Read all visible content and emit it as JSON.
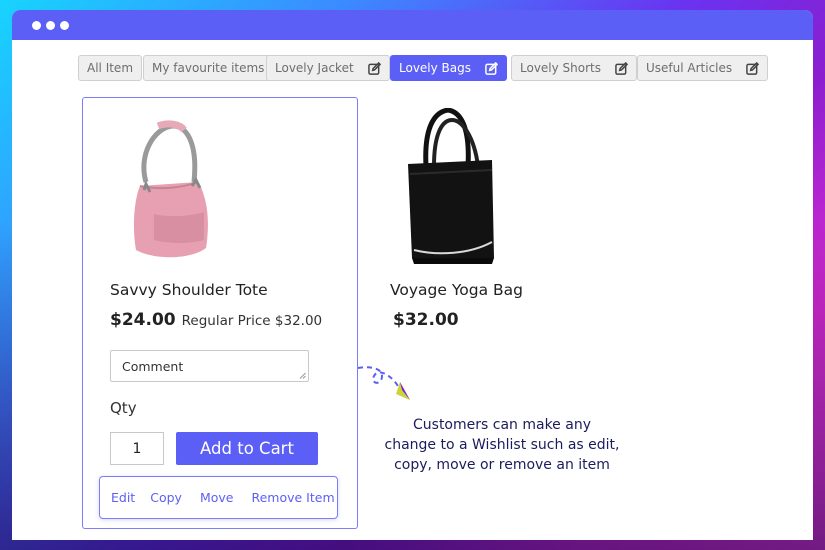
{
  "window": {
    "dots": 3,
    "accent_color": "#5c5ff6"
  },
  "tabs": [
    {
      "label": "All Item",
      "editable": false,
      "active": false
    },
    {
      "label": "My favourite items",
      "editable": false,
      "active": false
    },
    {
      "label": "Lovely Jacket",
      "editable": true,
      "active": false
    },
    {
      "label": "Lovely Bags",
      "editable": true,
      "active": true
    },
    {
      "label": "Lovely Shorts",
      "editable": true,
      "active": false
    },
    {
      "label": "Useful Articles",
      "editable": true,
      "active": false
    }
  ],
  "products": [
    {
      "name": "Savvy Shoulder Tote",
      "price": "$24.00",
      "regular_price_label": "Regular Price $32.00",
      "image": "pink-shoulder-bag",
      "comment_placeholder": "Comment",
      "qty_label": "Qty",
      "qty_value": "1",
      "add_to_cart_label": "Add to Cart",
      "actions": [
        "Edit",
        "Copy",
        "Move",
        "Remove Item"
      ]
    },
    {
      "name": "Voyage Yoga Bag",
      "price": "$32.00",
      "image": "black-tote-bag"
    }
  ],
  "annotation": {
    "text_line1": "Customers can make any",
    "text_line2": "change to a Wishlist such as edit,",
    "text_line3": "copy, move or remove an item"
  }
}
